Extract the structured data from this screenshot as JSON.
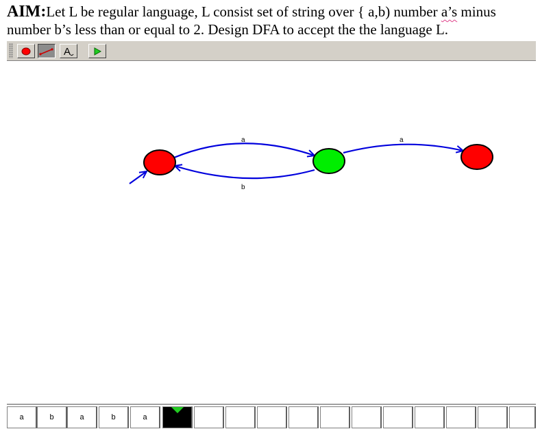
{
  "aim": {
    "label": "AIM:",
    "text_part1": "Let L be regular language, L consist set of string over { a,b) number ",
    "text_squiggle": "a’s",
    "text_part2": " minus number b’s less than or equal to 2. Design DFA to accept the the language L."
  },
  "toolbar": {
    "tools": [
      {
        "name": "state-tool",
        "icon": "red-circle-icon"
      },
      {
        "name": "transition-tool",
        "icon": "arrow-line-icon",
        "pressed": true
      },
      {
        "name": "label-tool",
        "icon": "text-a-icon",
        "glyph": "A"
      },
      {
        "name": "run-tool",
        "icon": "green-play-icon"
      }
    ]
  },
  "diagram": {
    "states": [
      {
        "id": "q0",
        "color": "#ff0000",
        "initial": true
      },
      {
        "id": "q1",
        "color": "#00ee00"
      },
      {
        "id": "q2",
        "color": "#ff0000"
      }
    ],
    "transitions": [
      {
        "from": "q0",
        "to": "q1",
        "label": "a"
      },
      {
        "from": "q1",
        "to": "q0",
        "label": "b"
      },
      {
        "from": "q1",
        "to": "q2",
        "label": "a"
      }
    ],
    "edge_color": "#0000dd"
  },
  "tape": {
    "symbols": [
      "a",
      "b",
      "a",
      "b",
      "a",
      "",
      "",
      "",
      "",
      "",
      "",
      "",
      "",
      "",
      "",
      "",
      ""
    ],
    "head_index": 5,
    "head_color": "#22cc22"
  }
}
